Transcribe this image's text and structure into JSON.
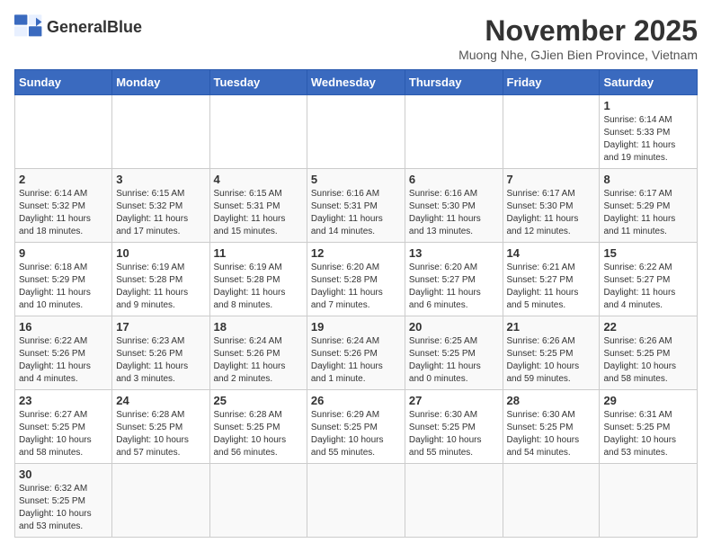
{
  "header": {
    "logo_text_normal": "General",
    "logo_text_bold": "Blue",
    "month_title": "November 2025",
    "subtitle": "Muong Nhe, GJien Bien Province, Vietnam"
  },
  "weekdays": [
    "Sunday",
    "Monday",
    "Tuesday",
    "Wednesday",
    "Thursday",
    "Friday",
    "Saturday"
  ],
  "weeks": [
    [
      {
        "day": "",
        "info": ""
      },
      {
        "day": "",
        "info": ""
      },
      {
        "day": "",
        "info": ""
      },
      {
        "day": "",
        "info": ""
      },
      {
        "day": "",
        "info": ""
      },
      {
        "day": "",
        "info": ""
      },
      {
        "day": "1",
        "info": "Sunrise: 6:14 AM\nSunset: 5:33 PM\nDaylight: 11 hours\nand 19 minutes."
      }
    ],
    [
      {
        "day": "2",
        "info": "Sunrise: 6:14 AM\nSunset: 5:32 PM\nDaylight: 11 hours\nand 18 minutes."
      },
      {
        "day": "3",
        "info": "Sunrise: 6:15 AM\nSunset: 5:32 PM\nDaylight: 11 hours\nand 17 minutes."
      },
      {
        "day": "4",
        "info": "Sunrise: 6:15 AM\nSunset: 5:31 PM\nDaylight: 11 hours\nand 15 minutes."
      },
      {
        "day": "5",
        "info": "Sunrise: 6:16 AM\nSunset: 5:31 PM\nDaylight: 11 hours\nand 14 minutes."
      },
      {
        "day": "6",
        "info": "Sunrise: 6:16 AM\nSunset: 5:30 PM\nDaylight: 11 hours\nand 13 minutes."
      },
      {
        "day": "7",
        "info": "Sunrise: 6:17 AM\nSunset: 5:30 PM\nDaylight: 11 hours\nand 12 minutes."
      },
      {
        "day": "8",
        "info": "Sunrise: 6:17 AM\nSunset: 5:29 PM\nDaylight: 11 hours\nand 11 minutes."
      }
    ],
    [
      {
        "day": "9",
        "info": "Sunrise: 6:18 AM\nSunset: 5:29 PM\nDaylight: 11 hours\nand 10 minutes."
      },
      {
        "day": "10",
        "info": "Sunrise: 6:19 AM\nSunset: 5:28 PM\nDaylight: 11 hours\nand 9 minutes."
      },
      {
        "day": "11",
        "info": "Sunrise: 6:19 AM\nSunset: 5:28 PM\nDaylight: 11 hours\nand 8 minutes."
      },
      {
        "day": "12",
        "info": "Sunrise: 6:20 AM\nSunset: 5:28 PM\nDaylight: 11 hours\nand 7 minutes."
      },
      {
        "day": "13",
        "info": "Sunrise: 6:20 AM\nSunset: 5:27 PM\nDaylight: 11 hours\nand 6 minutes."
      },
      {
        "day": "14",
        "info": "Sunrise: 6:21 AM\nSunset: 5:27 PM\nDaylight: 11 hours\nand 5 minutes."
      },
      {
        "day": "15",
        "info": "Sunrise: 6:22 AM\nSunset: 5:27 PM\nDaylight: 11 hours\nand 4 minutes."
      }
    ],
    [
      {
        "day": "16",
        "info": "Sunrise: 6:22 AM\nSunset: 5:26 PM\nDaylight: 11 hours\nand 4 minutes."
      },
      {
        "day": "17",
        "info": "Sunrise: 6:23 AM\nSunset: 5:26 PM\nDaylight: 11 hours\nand 3 minutes."
      },
      {
        "day": "18",
        "info": "Sunrise: 6:24 AM\nSunset: 5:26 PM\nDaylight: 11 hours\nand 2 minutes."
      },
      {
        "day": "19",
        "info": "Sunrise: 6:24 AM\nSunset: 5:26 PM\nDaylight: 11 hours\nand 1 minute."
      },
      {
        "day": "20",
        "info": "Sunrise: 6:25 AM\nSunset: 5:25 PM\nDaylight: 11 hours\nand 0 minutes."
      },
      {
        "day": "21",
        "info": "Sunrise: 6:26 AM\nSunset: 5:25 PM\nDaylight: 10 hours\nand 59 minutes."
      },
      {
        "day": "22",
        "info": "Sunrise: 6:26 AM\nSunset: 5:25 PM\nDaylight: 10 hours\nand 58 minutes."
      }
    ],
    [
      {
        "day": "23",
        "info": "Sunrise: 6:27 AM\nSunset: 5:25 PM\nDaylight: 10 hours\nand 58 minutes."
      },
      {
        "day": "24",
        "info": "Sunrise: 6:28 AM\nSunset: 5:25 PM\nDaylight: 10 hours\nand 57 minutes."
      },
      {
        "day": "25",
        "info": "Sunrise: 6:28 AM\nSunset: 5:25 PM\nDaylight: 10 hours\nand 56 minutes."
      },
      {
        "day": "26",
        "info": "Sunrise: 6:29 AM\nSunset: 5:25 PM\nDaylight: 10 hours\nand 55 minutes."
      },
      {
        "day": "27",
        "info": "Sunrise: 6:30 AM\nSunset: 5:25 PM\nDaylight: 10 hours\nand 55 minutes."
      },
      {
        "day": "28",
        "info": "Sunrise: 6:30 AM\nSunset: 5:25 PM\nDaylight: 10 hours\nand 54 minutes."
      },
      {
        "day": "29",
        "info": "Sunrise: 6:31 AM\nSunset: 5:25 PM\nDaylight: 10 hours\nand 53 minutes."
      }
    ],
    [
      {
        "day": "30",
        "info": "Sunrise: 6:32 AM\nSunset: 5:25 PM\nDaylight: 10 hours\nand 53 minutes."
      },
      {
        "day": "",
        "info": ""
      },
      {
        "day": "",
        "info": ""
      },
      {
        "day": "",
        "info": ""
      },
      {
        "day": "",
        "info": ""
      },
      {
        "day": "",
        "info": ""
      },
      {
        "day": "",
        "info": ""
      }
    ]
  ]
}
